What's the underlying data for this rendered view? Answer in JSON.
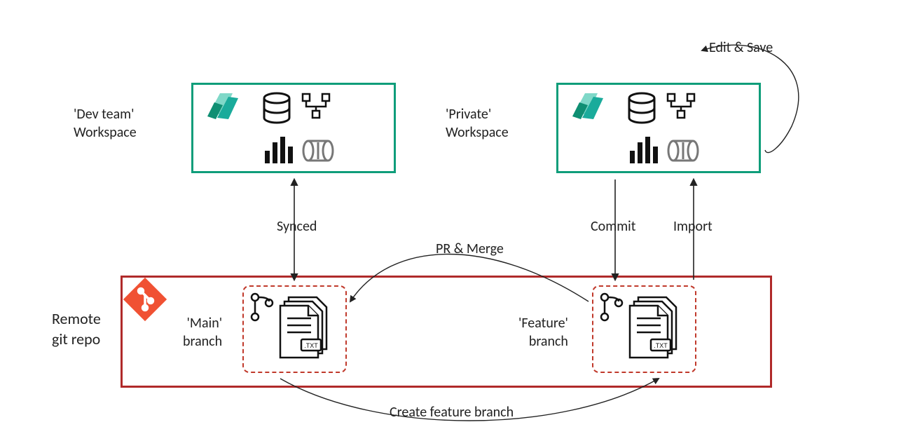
{
  "labels": {
    "dev_workspace": "'Dev team'\nWorkspace",
    "private_workspace": "'Private'\nWorkspace",
    "remote_repo": "Remote\ngit repo",
    "main_branch": "'Main'\nbranch",
    "feature_branch": "'Feature'\nbranch",
    "synced": "Synced",
    "edit_save": "Edit & Save",
    "commit": "Commit",
    "import": "Import",
    "pr_merge": "PR & Merge",
    "create_branch": "Create feature branch"
  },
  "icons": {
    "fabric": "fabric-logo",
    "git": "git-logo",
    "branch": "git-branch-icon",
    "files": "text-files-icon",
    "database": "database-icon",
    "pipeline": "pipeline-icon",
    "bar_chart": "bar-chart-icon",
    "cylinder": "cylinder-icon"
  },
  "colors": {
    "workspace_border": "#0f9d7a",
    "repo_border": "#b02a2a",
    "branch_dash": "#c0392b",
    "git_logo": "#f05133",
    "fabric_teal1": "#1aab9b",
    "fabric_teal2": "#0f9d7a"
  }
}
